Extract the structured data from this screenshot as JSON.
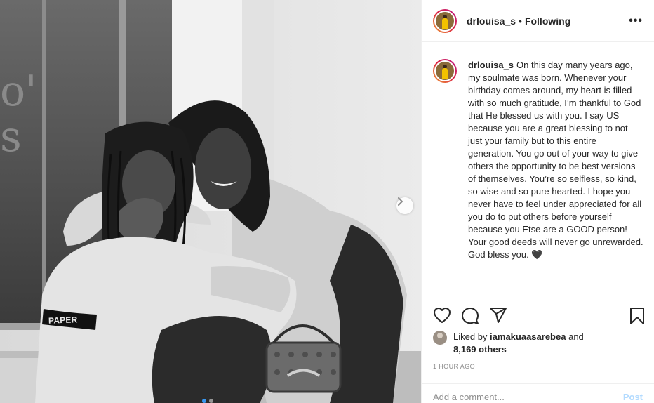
{
  "post": {
    "username": "drlouisa_s",
    "separator": "•",
    "follow_status": "Following",
    "more_label": "•••",
    "photo_alt": "Black and white photo of two people embracing"
  },
  "photo": {
    "paper_text": "PAPER"
  },
  "caption": {
    "username": "drlouisa_s",
    "text": "On this day many years ago, my soulmate was born. Whenever your birthday comes around, my heart is filled with so much gratitude, I’m thankful to God that He blessed us with you. I say US because you are a great blessing to not just your family but to this entire generation. You go out of your way to give others the opportunity to be best versions of themselves. You’re so selfless, so kind, so wise and so pure hearted. I hope you never have to feel under appreciated for all you do to put others before yourself because you Etse are a GOOD person! Your good deeds will never go unrewarded. God bless you. 🖤"
  },
  "likes": {
    "prefix": "Liked by",
    "user": "iamakuaasarebea",
    "conjunction": "and",
    "others": "8,169 others"
  },
  "timestamp": "1 HOUR AGO",
  "comment": {
    "placeholder": "Add a comment...",
    "post_label": "Post"
  },
  "icons": [
    "heart-icon",
    "comment-icon",
    "share-icon",
    "bookmark-icon",
    "chevron-right-icon"
  ],
  "colors": {
    "link_blue": "#3897f0",
    "post_disabled": "#b3dbff",
    "muted": "#8e8e8e",
    "text": "#262626"
  }
}
